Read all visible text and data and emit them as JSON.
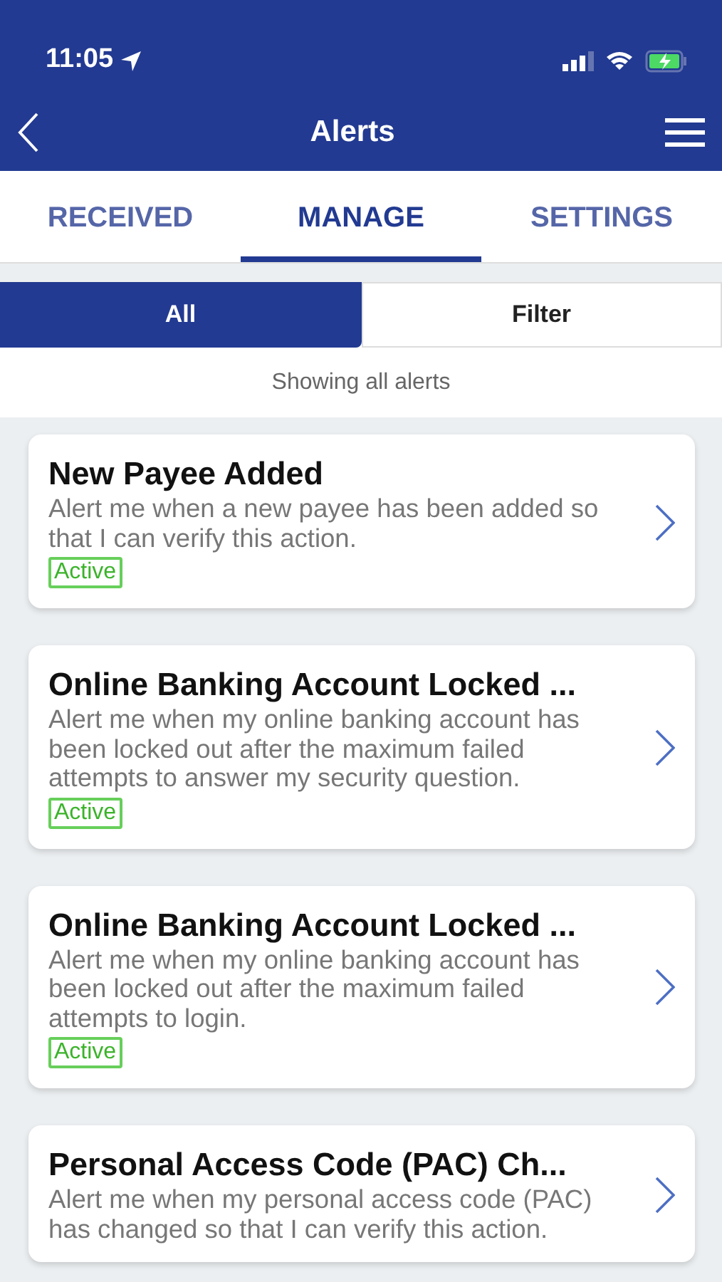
{
  "status_bar": {
    "time": "11:05"
  },
  "header": {
    "title": "Alerts"
  },
  "tabs": [
    {
      "label": "RECEIVED",
      "selected": false
    },
    {
      "label": "MANAGE",
      "selected": true
    },
    {
      "label": "SETTINGS",
      "selected": false
    }
  ],
  "segments": [
    {
      "label": "All",
      "selected": true
    },
    {
      "label": "Filter",
      "selected": false
    }
  ],
  "summary": "Showing all alerts",
  "alerts": [
    {
      "title": "New Payee Added",
      "description": "Alert me when a new payee has been added so that I can verify this action.",
      "status": "Active"
    },
    {
      "title": "Online Banking Account Locked ...",
      "description": "Alert me when my online banking account has been locked out after the maximum failed attempts to answer my security question.",
      "status": "Active"
    },
    {
      "title": "Online Banking Account Locked ...",
      "description": "Alert me when my online banking account has been locked out after the maximum failed attempts to login.",
      "status": "Active"
    },
    {
      "title": "Personal Access Code (PAC) Ch...",
      "description": "Alert me when my personal access code (PAC) has changed so that I can verify this action."
    }
  ]
}
